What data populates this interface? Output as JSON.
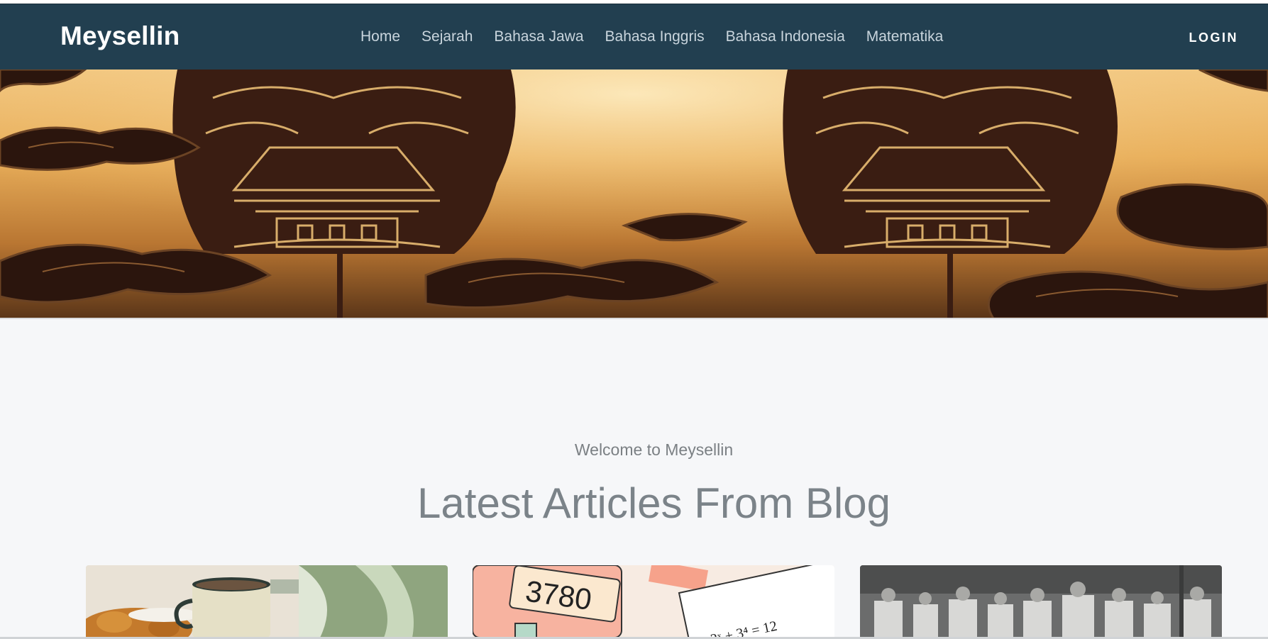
{
  "brand": "Meysellin",
  "nav": {
    "items": [
      "Home",
      "Sejarah",
      "Bahasa Jawa",
      "Bahasa Inggris",
      "Bahasa Indonesia",
      "Matematika"
    ],
    "login": "LOGIN"
  },
  "hero": {
    "image": "batik-wayang-gunungan-banner"
  },
  "section": {
    "welcome": "Welcome to Meysellin",
    "title": "Latest Articles From Blog"
  },
  "cards": [
    {
      "image": "coffee-and-fried-snacks-photo"
    },
    {
      "image": "math-calculator-illustration",
      "calculator_display": "3780",
      "formula": "2ˣ + 3⁴ = 12"
    },
    {
      "image": "historical-group-photo"
    }
  ],
  "colors": {
    "navbar": "#223f50",
    "background": "#f6f7f9",
    "heading": "#7b8389"
  }
}
